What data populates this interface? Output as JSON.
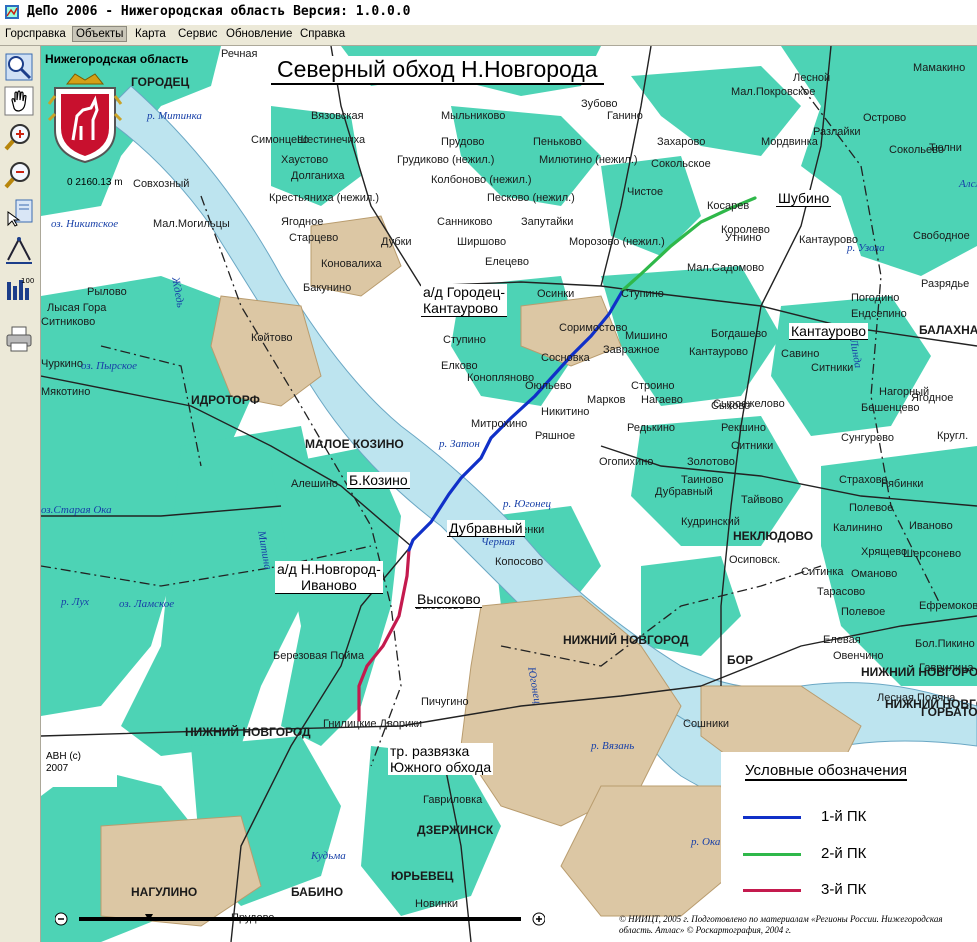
{
  "window": {
    "title": "ДеПо 2006 - Нижегородская область Версия: 1.0.0.0"
  },
  "menu": [
    {
      "label": "Горсправка",
      "active": false
    },
    {
      "label": "Объекты",
      "active": true
    },
    {
      "label": "Карта",
      "active": false
    },
    {
      "label": "Сервис",
      "active": false
    },
    {
      "label": "Обновление",
      "active": false
    },
    {
      "label": "Справка",
      "active": false
    }
  ],
  "toolbar": {
    "tools": [
      {
        "name": "zoom-extent-icon"
      },
      {
        "name": "pan-hand-icon"
      },
      {
        "name": "zoom-in-icon"
      },
      {
        "name": "zoom-out-icon"
      },
      {
        "name": "select-object-icon"
      },
      {
        "name": "measure-icon"
      },
      {
        "name": "zoom-100-icon",
        "text": "100%"
      },
      {
        "name": "print-icon"
      }
    ]
  },
  "map": {
    "region_name": "Нижегородская область",
    "scale_label": "0    2160.13 m",
    "title": "Северный обход Н.Новгорода",
    "small_copyright": "АВН (c)\n2007",
    "credits": "© НИИЦТ, 2005 г. Подготовлено по материалам «Регионы России. Нижегородская область. Атлас» © Роскартография, 2004 г.",
    "colors": {
      "water": "#4dd3b5",
      "river": "#bde4ef",
      "land": "#ffffff",
      "urban": "#dcc7a4",
      "road": "#222222",
      "route_1": "#1030c8",
      "route_2": "#2fb84a",
      "route_3": "#c41a4e"
    },
    "callouts": [
      {
        "id": "shubino",
        "text": "Шубино"
      },
      {
        "id": "gorodets",
        "text": "а/д Городец-\nКантаурово"
      },
      {
        "id": "kantaurovo",
        "text": "Кантаурово"
      },
      {
        "id": "bkozino",
        "text": "Б.Козино"
      },
      {
        "id": "dubravny",
        "text": "Дубравный"
      },
      {
        "id": "ivanovo",
        "text": "а/д Н.Новгород-\nИваново"
      },
      {
        "id": "vysokovo",
        "text": "Высоково"
      },
      {
        "id": "razvyazka",
        "text": "тр. развязка\nЮжного обхода"
      }
    ],
    "places": [
      "Нижегородская область",
      "Речная",
      "ГОРОДЕЦ",
      "Вязовская",
      "Мыльниково",
      "Зубово",
      "Ганино",
      "Мал.Покровское",
      "Лесной",
      "Мамакино",
      "Симонцево",
      "Шестинечиха",
      "Прудово",
      "Пеньково",
      "Захарово",
      "Мордвинка",
      "Разлайки",
      "Острово",
      "Хаустово",
      "Грудиково (нежил.)",
      "Милютино (нежил.)",
      "Сокольское",
      "Долганиха",
      "Колбоново (нежил.)",
      "Сокольево",
      "Тюлни",
      "Крестьяниха (нежил.)",
      "Песково (нежил.)",
      "Косарев",
      "Шубино",
      "Совхозный",
      "Ягодное",
      "Чистое",
      "Санниково",
      "Запутайки",
      "Мал.Могильцы",
      "Королево",
      "Свободное",
      "Старцево",
      "Дубки",
      "Ширшово",
      "Морозово (нежил.)",
      "Утнино",
      "Кантаурово",
      "Мал.Садомово",
      "Лихачи",
      "Бакунино",
      "Коновалиха",
      "Елецево",
      "Осинки",
      "Ступино",
      "Разрядье",
      "Погодино",
      "Ендсепино",
      "Лысая Гора",
      "Рылово",
      "Ситниково",
      "Соримостово",
      "Мишино",
      "Богдашево",
      "Кантаурово",
      "Савино",
      "Долтово",
      "БАЛАХНА",
      "Койтово",
      "Ступино",
      "Завражное",
      "Сосновка",
      "Ситники",
      "Чуркино",
      "Елково",
      "Конопляново",
      "Оюльево",
      "Строино",
      "Сыхово",
      "Нагорный",
      "ИДРОТОРФ",
      "Никитино",
      "Марков",
      "Нагаево",
      "Сыроежелово",
      "Бешенцево",
      "Ягодное",
      "Мякотино",
      "Митрохино",
      "Ряшное",
      "Редькино",
      "Рекшино",
      "Сунгурово",
      "МАЛОЕ КОЗИНО",
      "Огопихино",
      "Золотово",
      "Ситники",
      "Кругл.",
      "Б.Козино",
      "Алешино",
      "Кольцово",
      "Полевое",
      "Страхово",
      "Рябинки",
      "Каменки",
      "Дубравный",
      "Таиново",
      "Тайвово",
      "Калинино",
      "Кудринский",
      "НЕКЛЮДОВО",
      "Шерсонево",
      "Иваново",
      "Осиповск.",
      "Хрящево",
      "Оманово",
      "Ситинка",
      "Тарасово",
      "Копосово",
      "Высоково",
      "НИЖНИЙ НОВГОРОД",
      "Полевое",
      "Ефремоково",
      "Березовая Пойма",
      "БОР",
      "Елевая",
      "Овенчино",
      "Бол.Пикино",
      "Гаврилица",
      "НИЖНИЙ НОВГОРОД",
      "Пичугино",
      "Лесная Поляна",
      "Гнилицкие Дворики",
      "НИЖНИЙ НОВГОРОД",
      "Сошники",
      "НИЖНИЙ НОВГОРОД",
      "ГОРБАТОВКА",
      "Гавриловка",
      "ДЗЕРЖИНСК",
      "ЮРЬЕВЕЦ",
      "НАГУЛИНО",
      "БАБИНО",
      "Новинки",
      "Прудово",
      "Ламское"
    ],
    "rivers": [
      "р. Митинка",
      "оз. Никитское",
      "Ждедь",
      "оз. Пырское",
      "р. Затон",
      "р. Югонец",
      "Черная",
      "оз.Старая Ока",
      "р. Лух",
      "оз. Ламское",
      "Митина",
      "р. Узола",
      "Алсма",
      "Линда",
      "р. Ока",
      "р. Вязань",
      "Югонец",
      "Кудьма"
    ]
  },
  "legend": {
    "title": "Условные обозначения",
    "items": [
      {
        "label": "1-й ПК",
        "color": "#1030c8"
      },
      {
        "label": "2-й ПК",
        "color": "#2fb84a"
      },
      {
        "label": "3-й ПК",
        "color": "#c41a4e"
      }
    ]
  }
}
